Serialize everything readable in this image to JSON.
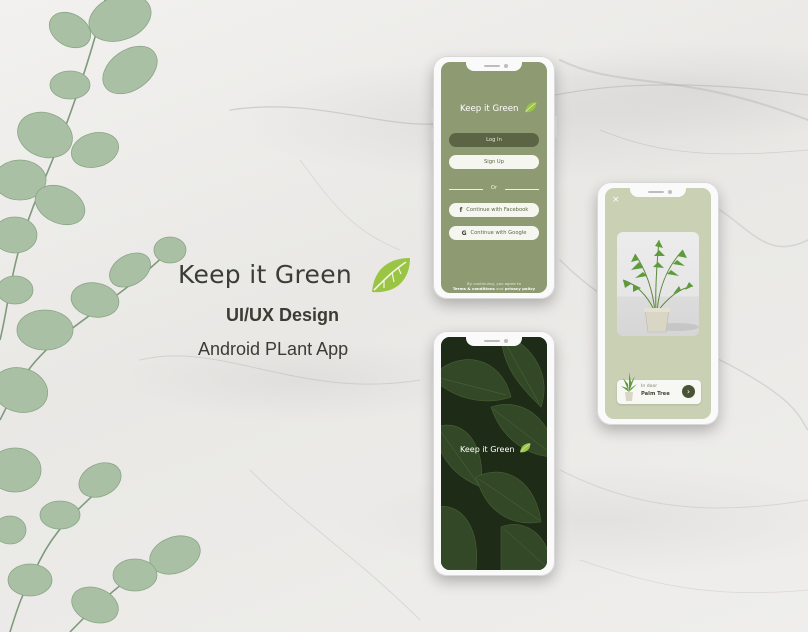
{
  "brand": {
    "title": "Keep it Green",
    "subtitle": "UI/UX Design",
    "tagline": "Android PLant App"
  },
  "login_screen": {
    "app_name": "Keep it Green",
    "login_label": "Log In",
    "signup_label": "Sign Up",
    "or_label": "Or",
    "facebook_label": "Continue with Facebook",
    "google_label": "Continue with Google",
    "terms_prefix": "By continuing, you agree to",
    "terms_link": "Terms & conditions",
    "terms_and": "and",
    "privacy_link": "privacy policy"
  },
  "splash_screen": {
    "app_name": "Keep it Green"
  },
  "plant_screen": {
    "close_icon": "×",
    "category": "In door",
    "plant_name": "Palm Tree",
    "next_icon": "›"
  },
  "colors": {
    "brand_green": "#8e9a72",
    "dark_button": "#5b6444",
    "leaf_green": "#9ac443",
    "text_dark": "#3b3d34"
  }
}
